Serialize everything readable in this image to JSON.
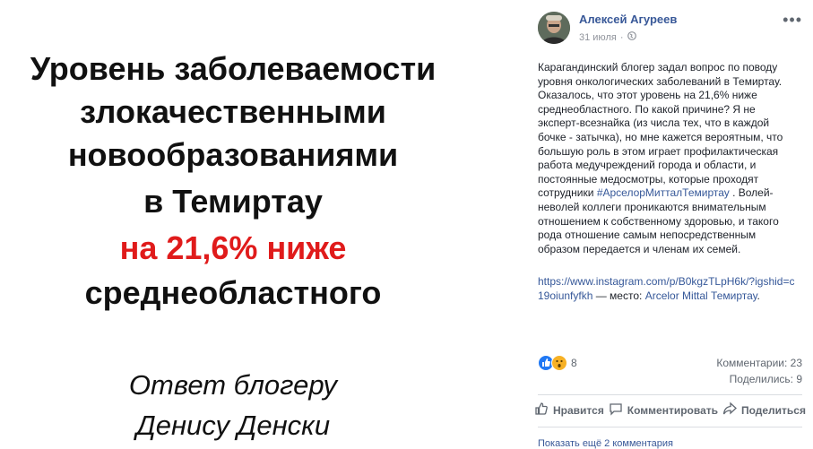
{
  "image": {
    "lines": [
      "Уровень заболеваемости",
      "злокачественными",
      "новообразованиями",
      "в Темиртау",
      "на 21,6% ниже",
      "среднеобластного",
      "Ответ блогеру",
      "Денису Денски"
    ]
  },
  "post": {
    "author": "Алексей Агуреев",
    "date": "31 июля",
    "text_part1": "Карагандинский блогер задал вопрос по поводу уровня онкологических заболеваний в Темиртау. Оказалось, что этот уровень на 21,6% ниже среднеобластного. По какой причине? Я не эксперт-всезнайка (из числа тех, что в каждой бочке - затычка), но мне кажется вероятным, что большую роль в этом играет профилактическая работа медучреждений города и области, и постоянные медосмотры, которые проходят сотрудники ",
    "hashtag": "#АрселорМитталТемиртау",
    "text_part2": " . Волей-неволей коллеги проникаются внимательным отношением к собственному здоровью, и такого рода отношение самым непосредственным образом передается и членам их семей.",
    "link_url": "https://www.instagram.com/p/B0kgzTLpH6k/?igshid=c19oiunfyfkh",
    "place_sep": " — место: ",
    "place": "Arcelor Mittal Темиртау",
    "place_end": "."
  },
  "stats": {
    "reactions": "8",
    "comments": "Комментарии: 23",
    "shares": "Поделились: 9"
  },
  "actions": {
    "like": "Нравится",
    "comment": "Комментировать",
    "share": "Поделиться"
  },
  "footer": {
    "more_comments": "Показать ещё 2 комментария"
  },
  "colors": {
    "link": "#365899",
    "highlight_red": "#e01b1b"
  }
}
